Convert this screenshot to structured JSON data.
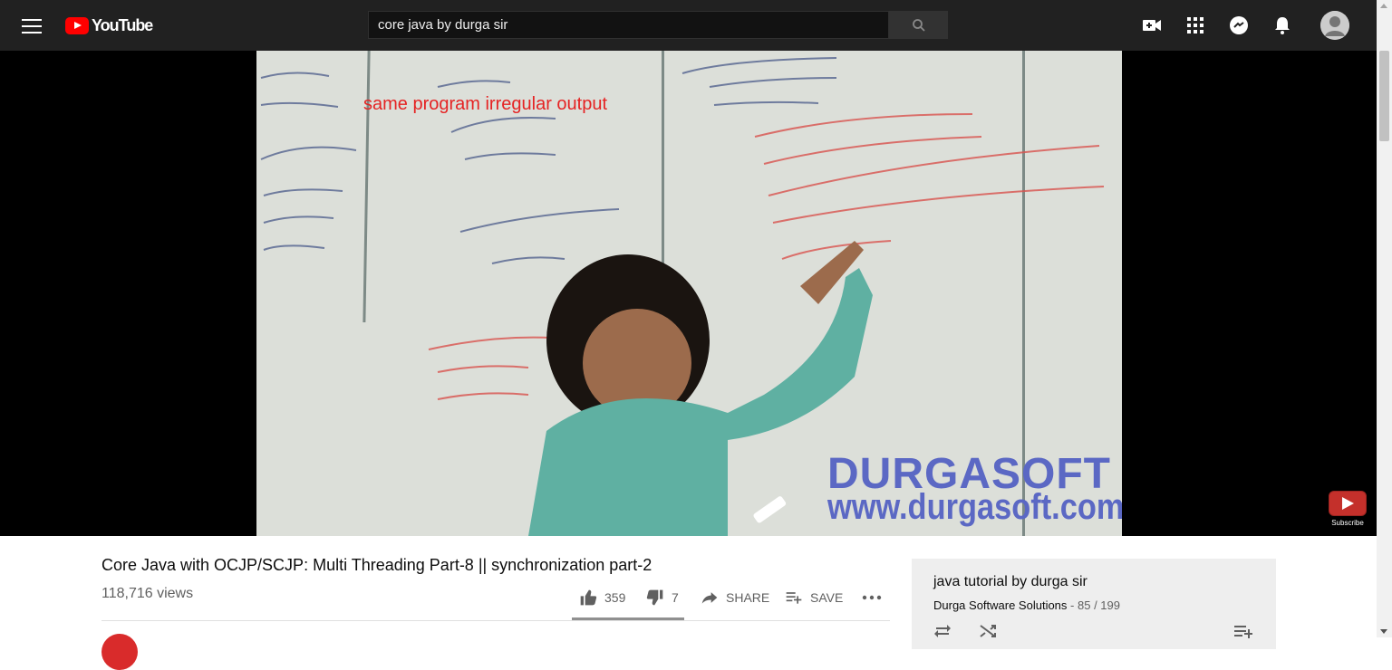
{
  "header": {
    "logo_text": "YouTube",
    "search_value": "core java by durga sir",
    "icons": [
      "menu-icon",
      "search-icon",
      "create-video-icon",
      "apps-icon",
      "messages-icon",
      "notifications-icon",
      "account-avatar"
    ]
  },
  "video": {
    "annotation": "same program irregular output",
    "watermark_line1": "DURGASOFT",
    "watermark_line2": "www.durgasoft.com",
    "subscribe_label": "Subscribe"
  },
  "info": {
    "title": "Core Java with OCJP/SCJP: Multi Threading Part-8 || synchronization part-2",
    "views": "118,716 views",
    "likes": "359",
    "dislikes": "7",
    "share_label": "SHARE",
    "save_label": "SAVE"
  },
  "playlist": {
    "title": "java tutorial by durga sir",
    "owner": "Durga Software Solutions",
    "position": "85 / 199"
  },
  "colors": {
    "topbar": "#212121",
    "brand_red": "#ff0000",
    "annotation_red": "#e52323",
    "watermark_blue": "#5b68c4"
  }
}
